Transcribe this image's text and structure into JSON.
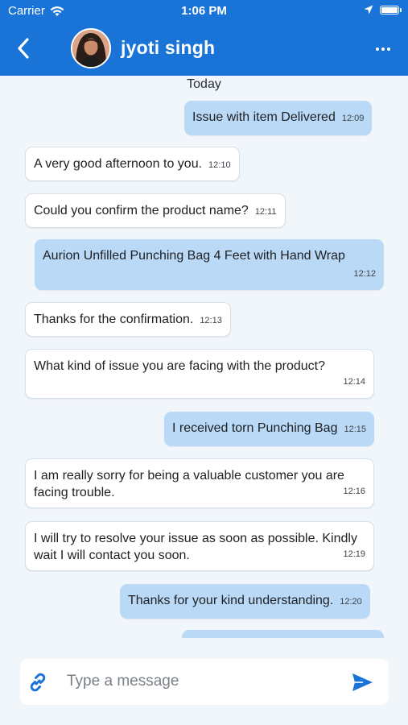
{
  "status_bar": {
    "carrier": "Carrier",
    "time": "1:06 PM"
  },
  "header": {
    "contact_name": "jyoti singh",
    "accent_color": "#1a73d6"
  },
  "chat": {
    "day_label": "Today",
    "messages": [
      {
        "direction": "outgoing",
        "text": "Issue with item Delivered",
        "time": "12:09"
      },
      {
        "direction": "incoming",
        "text": "A very good afternoon to you.",
        "time": "12:10"
      },
      {
        "direction": "incoming",
        "text": "Could you confirm the product name?",
        "time": "12:11"
      },
      {
        "direction": "outgoing",
        "text": "Aurion  Unfilled Punching Bag 4 Feet with Hand Wrap",
        "time": "12:12"
      },
      {
        "direction": "incoming",
        "text": "Thanks for the confirmation.",
        "time": "12:13"
      },
      {
        "direction": "incoming",
        "text": "What kind of issue you are facing with the product?",
        "time": "12:14"
      },
      {
        "direction": "outgoing",
        "text": "I received torn Punching Bag",
        "time": "12:15"
      },
      {
        "direction": "incoming",
        "text": "I am really sorry for being a valuable customer you are facing trouble.",
        "time": "12:16"
      },
      {
        "direction": "incoming",
        "text": "I will try to resolve your issue as soon as possible. Kindly wait I will contact you soon.",
        "time": "12:19"
      },
      {
        "direction": "outgoing",
        "text": "Thanks for your kind understanding.",
        "time": "12:20"
      }
    ],
    "incoming_bubble_color": "#ffffff",
    "outgoing_bubble_color": "#b9d9f7"
  },
  "composer": {
    "placeholder": "Type a message",
    "value": ""
  }
}
